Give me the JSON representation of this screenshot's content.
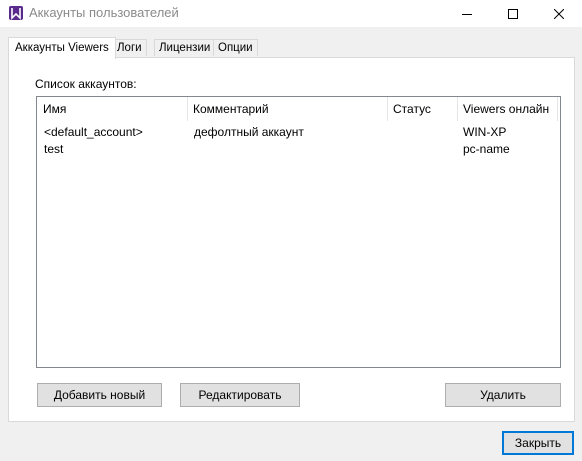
{
  "window": {
    "title": "Аккаунты пользователей",
    "icon": "purple-viewer-app-icon",
    "minimize_icon": "minimize-icon",
    "maximize_icon": "maximize-icon",
    "close_icon": "close-icon"
  },
  "tabs": [
    {
      "label": "Аккаунты Viewers",
      "active": true
    },
    {
      "label": "Логи",
      "active": false
    },
    {
      "label": "Лицензии",
      "active": false
    },
    {
      "label": "Опции",
      "active": false
    }
  ],
  "accounts": {
    "list_label": "Список аккаунтов:",
    "columns": [
      "Имя",
      "Комментарий",
      "Статус",
      "Viewers онлайн"
    ],
    "rows": [
      {
        "name": "<default_account>",
        "comment": "дефолтный аккаунт",
        "status": "",
        "viewers_online": "WIN-XP"
      },
      {
        "name": "test",
        "comment": "",
        "status": "",
        "viewers_online": "pc-name"
      }
    ]
  },
  "buttons": {
    "add_new": "Добавить новый",
    "edit": "Редактировать",
    "delete": "Удалить",
    "close": "Закрыть"
  },
  "colors": {
    "app_icon": "#5a2a8c",
    "default_button_border": "#0078d7"
  }
}
